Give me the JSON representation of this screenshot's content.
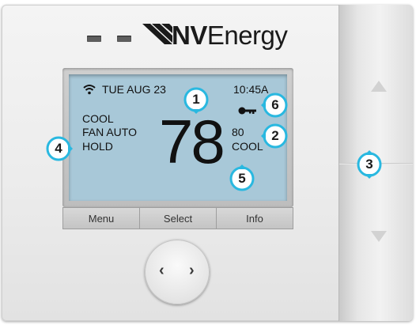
{
  "brand": {
    "prefix": "NV",
    "suffix": "Energy"
  },
  "status_bar": {
    "date": "TUE AUG 23",
    "time": "10:45A",
    "wifi_icon": "wifi-icon",
    "lock_icon": "key-lock-icon"
  },
  "modes": {
    "system_mode": "COOL",
    "fan_mode": "FAN AUTO",
    "hold_status": "HOLD"
  },
  "temperature": {
    "current": "78",
    "setpoint": "80",
    "setpoint_mode": "COOL"
  },
  "soft_buttons": {
    "menu": "Menu",
    "select": "Select",
    "info": "Info"
  },
  "nav_arrows": {
    "left": "‹",
    "right": "›"
  },
  "callouts": [
    "1",
    "2",
    "3",
    "4",
    "5",
    "6"
  ],
  "colors": {
    "callout_ring": "#29b8e0",
    "callout_fill": "#ffffff",
    "lcd_background": "#a8c8d8"
  }
}
